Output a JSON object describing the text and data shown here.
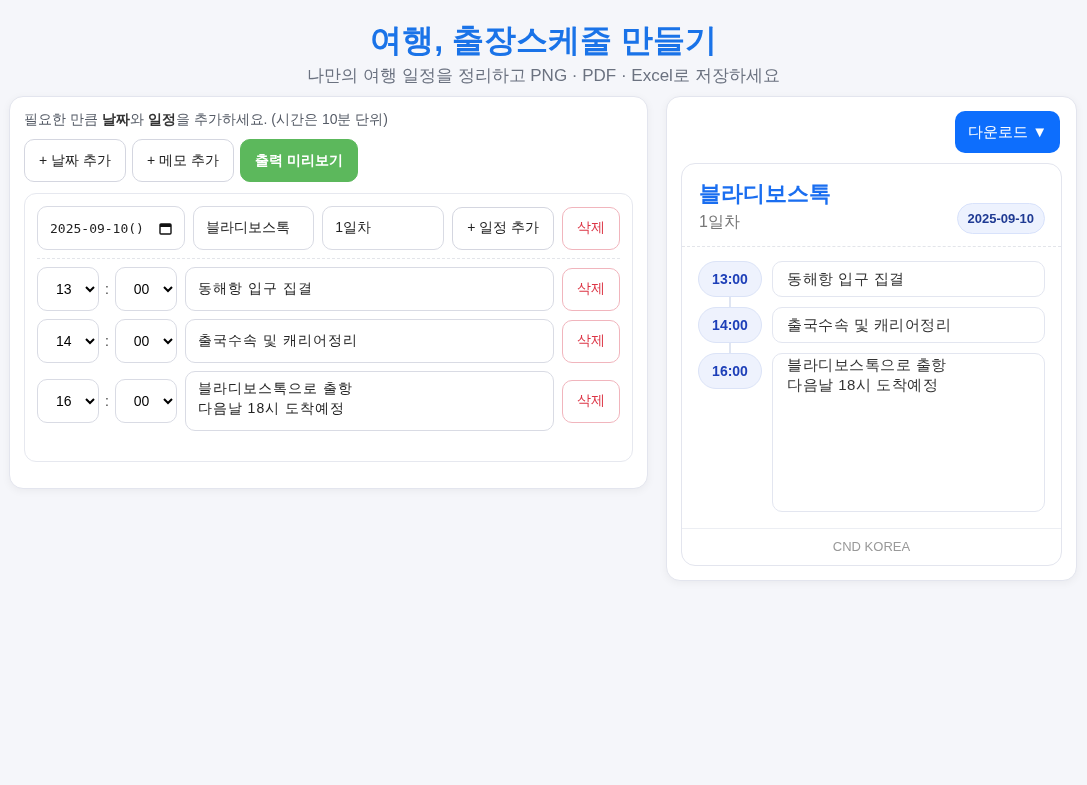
{
  "header": {
    "title": "여행, 출장스케줄 만들기",
    "subtitle": "나만의 여행 일정을 정리하고 PNG · PDF · Excel로 저장하세요"
  },
  "editor": {
    "intro": "필요한 만큼 **날짜**와 **일정**을 추가하세요. (시간은 10분 단위)",
    "buttons": [
      {
        "label": "+ 날짜 추가",
        "kind": "outline"
      },
      {
        "label": "+ 메모 추가",
        "kind": "outline"
      },
      {
        "label": "출력 미리보기",
        "kind": "primary"
      }
    ],
    "day": {
      "date": "2025-09-10()",
      "place": "블라디보스톡",
      "day_label": "1일차",
      "add_button": "+ 일정 추가",
      "delete_button": "삭제",
      "items": [
        {
          "hour": "13",
          "separator": ":",
          "minute": "00",
          "text": "동해항 입구 집결",
          "kind": "line",
          "delete_button": "삭제"
        },
        {
          "hour": "14",
          "separator": ":",
          "minute": "00",
          "text": "출국수속 및 캐리어정리",
          "kind": "line",
          "delete_button": "삭제"
        },
        {
          "hour": "16",
          "separator": ":",
          "minute": "00",
          "text": "블라디보스톡으로 출항\n다음날 18시 도착예정",
          "kind": "multiline",
          "delete_button": "삭제"
        }
      ]
    }
  },
  "preview": {
    "download_button": "다운로드 ▼",
    "title": "블라디보스톡",
    "subtitle": "1일차",
    "date_badge": "2025-09-10",
    "items": [
      {
        "time": "13:00",
        "text": "동해항 입구 집결",
        "kind": "line"
      },
      {
        "time": "14:00",
        "text": "출국수속 및 캐리어정리",
        "kind": "line"
      },
      {
        "time": "16:00",
        "text": "블라디보스톡으로 출항\n다음날 18시 도착예정",
        "kind": "multiline"
      }
    ],
    "footer": "CND KOREA"
  }
}
